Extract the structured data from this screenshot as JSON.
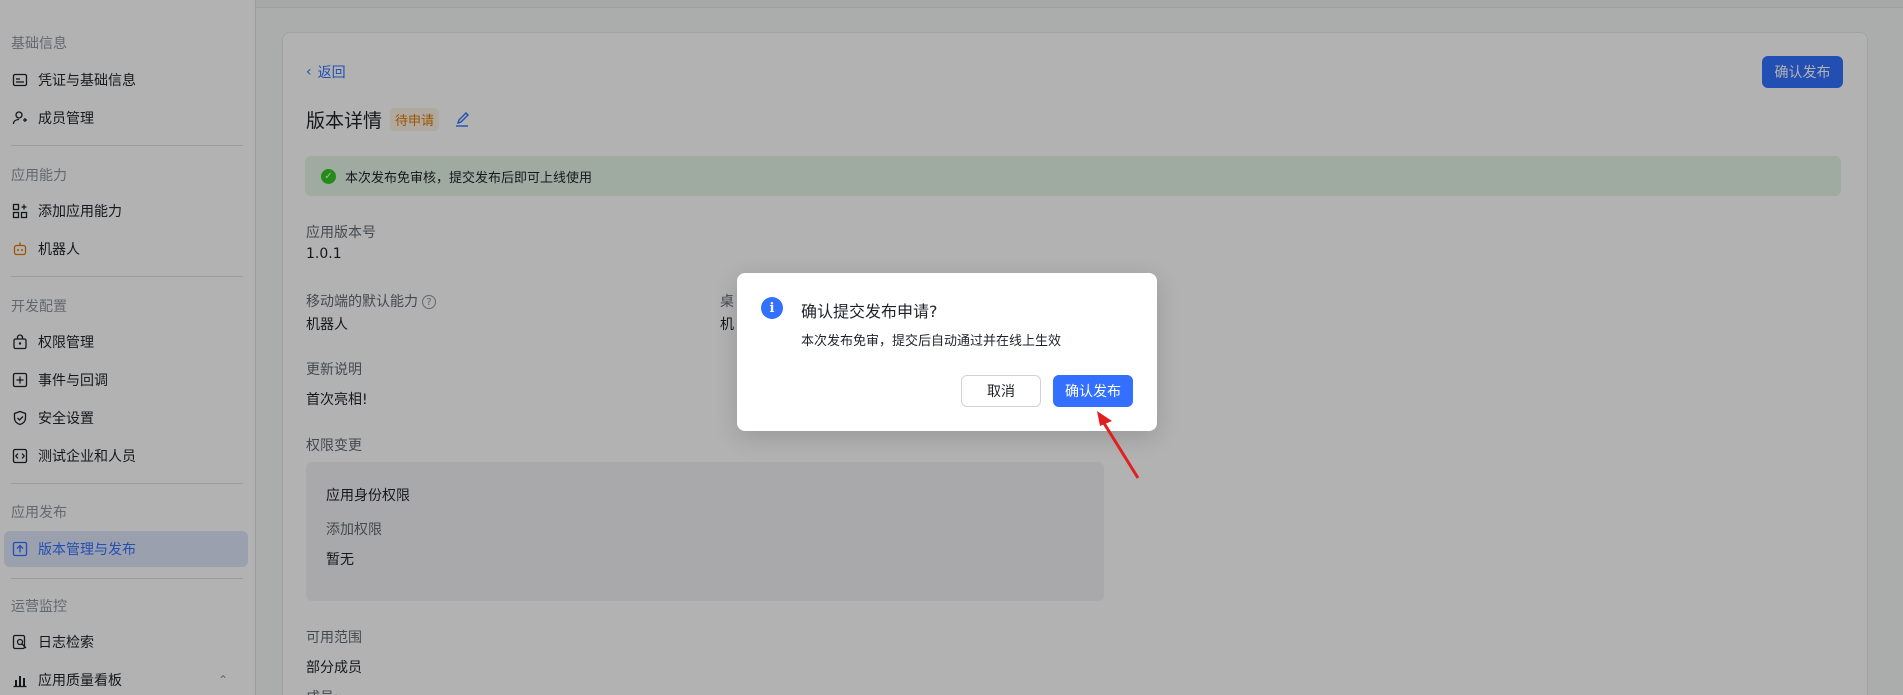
{
  "sidebar": {
    "groups": [
      {
        "title": "基础信息",
        "items": [
          {
            "label": "凭证与基础信息",
            "icon": "credential-icon"
          },
          {
            "label": "成员管理",
            "icon": "member-icon"
          }
        ]
      },
      {
        "title": "应用能力",
        "items": [
          {
            "label": "添加应用能力",
            "icon": "grid-plus-icon"
          },
          {
            "label": "机器人",
            "icon": "robot-icon"
          }
        ]
      },
      {
        "title": "开发配置",
        "items": [
          {
            "label": "权限管理",
            "icon": "lock-bag-icon"
          },
          {
            "label": "事件与回调",
            "icon": "event-icon"
          },
          {
            "label": "安全设置",
            "icon": "shield-icon"
          },
          {
            "label": "测试企业和人员",
            "icon": "code-icon"
          }
        ]
      },
      {
        "title": "应用发布",
        "items": [
          {
            "label": "版本管理与发布",
            "icon": "upload-icon",
            "active": true
          }
        ]
      },
      {
        "title": "运营监控",
        "items": [
          {
            "label": "日志检索",
            "icon": "log-search-icon"
          },
          {
            "label": "应用质量看板",
            "icon": "bar-chart-icon"
          }
        ]
      }
    ]
  },
  "main": {
    "back_label": "返回",
    "publish_button": "确认发布",
    "title": "版本详情",
    "status_badge": "待申请",
    "notice": "本次发布免审核，提交发布后即可上线使用",
    "version_label": "应用版本号",
    "version_value": "1.0.1",
    "mobile_default_label": "移动端的默认能力",
    "mobile_default_value": "机器人",
    "desktop_default_label": "桌",
    "desktop_default_value": "机",
    "update_label": "更新说明",
    "update_value": "首次亮相!",
    "perm_change_label": "权限变更",
    "perm_box": {
      "title": "应用身份权限",
      "sub_label": "添加权限",
      "sub_value": "暂无"
    },
    "scope_label": "可用范围",
    "scope_value": "部分成员",
    "members_label": "成员:"
  },
  "dialog": {
    "title": "确认提交发布申请?",
    "message": "本次发布免审，提交后自动通过并在线上生效",
    "cancel": "取消",
    "confirm": "确认发布"
  },
  "colors": {
    "accent": "#3370ff",
    "annotation_arrow": "#e02020"
  }
}
